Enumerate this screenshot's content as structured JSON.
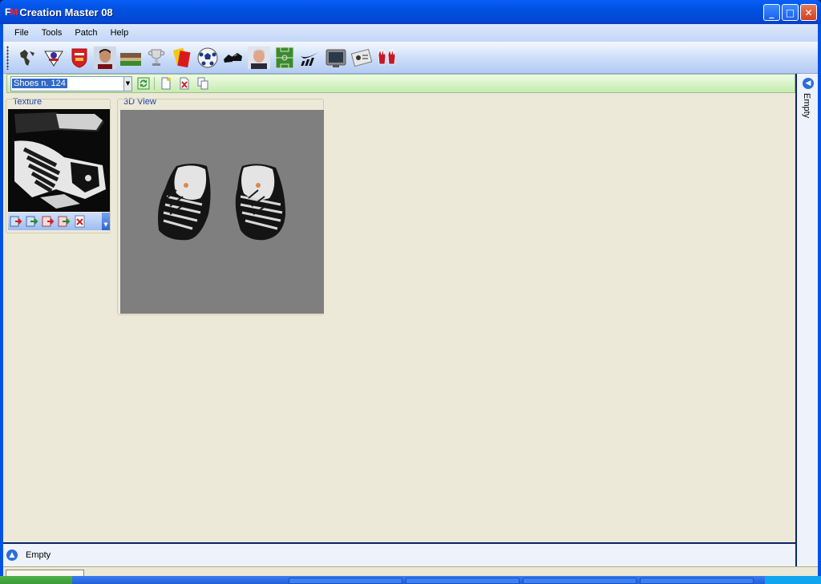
{
  "window": {
    "title": "Creation Master 08",
    "icon_letters_1": "F",
    "icon_letters_2": "M"
  },
  "menu": {
    "items": [
      "File",
      "Tools",
      "Patch",
      "Help"
    ]
  },
  "toolbar": {
    "icons": [
      "world-map-icon",
      "premier-league-icon",
      "arsenal-crest-icon",
      "player-face-icon",
      "stadium-icon",
      "trophy-icon",
      "referee-card-icon",
      "ball-icon",
      "shoes-icon",
      "manager-face-icon",
      "pitch-icon",
      "kit-brand-icon",
      "tv-icon",
      "scoreboard-icon",
      "gloves-icon"
    ]
  },
  "subbar": {
    "selected": "Shoes n. 124"
  },
  "panels": {
    "texture_label": "Texture",
    "view_label": "3D View"
  },
  "rightbar": {
    "label": "Empty"
  },
  "status": {
    "label": "Empty"
  },
  "colors": {
    "title_bar": "#0052e0",
    "client_bg": "#ece9d8",
    "view_bg": "#7f7f7f"
  }
}
